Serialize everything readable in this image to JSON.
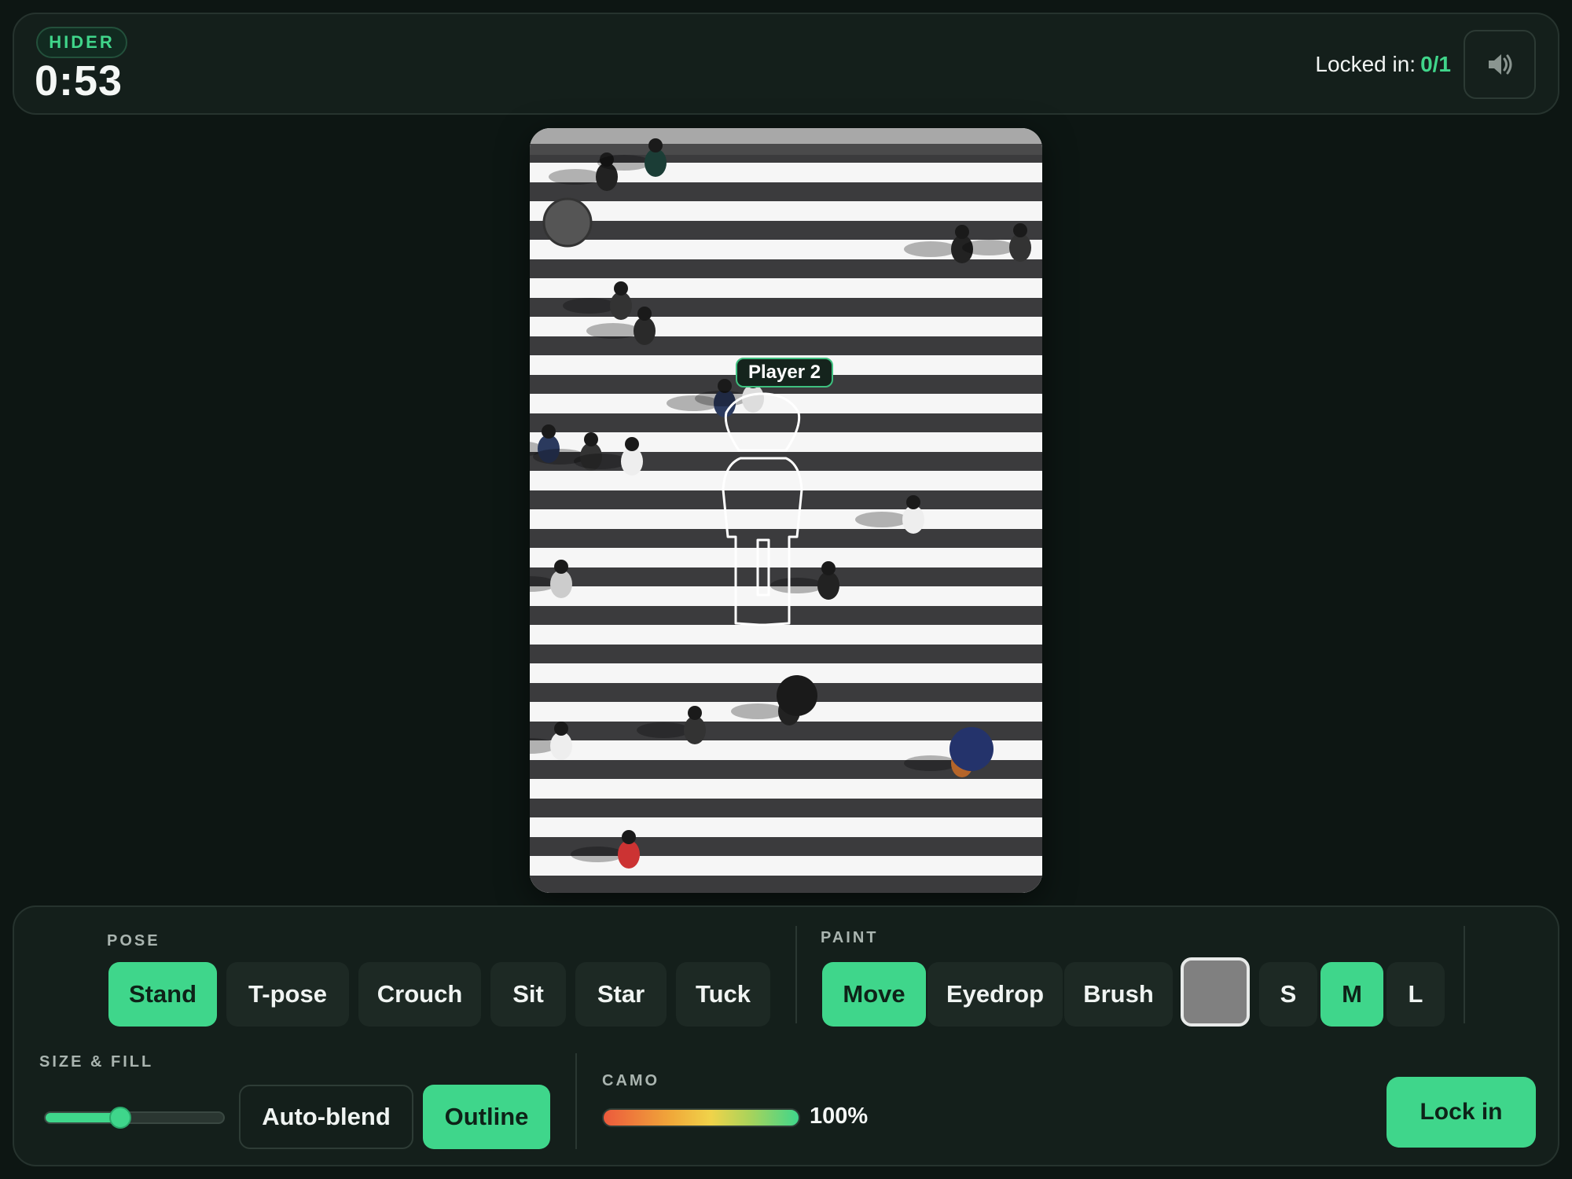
{
  "header": {
    "role": "HIDER",
    "timer": "0:53",
    "locked_label": "Locked in:",
    "locked_count": "0/1",
    "sound_icon": "speaker-icon"
  },
  "scene": {
    "player_tag": "Player 2"
  },
  "pose": {
    "label": "POSE",
    "options": [
      "Stand",
      "T-pose",
      "Crouch",
      "Sit",
      "Star",
      "Tuck"
    ],
    "selected": "Stand"
  },
  "paint": {
    "label": "PAINT",
    "tools": [
      "Move",
      "Eyedrop",
      "Brush"
    ],
    "selected_tool": "Move",
    "color": "#808080",
    "sizes": [
      "S",
      "M",
      "L"
    ],
    "selected_size": "M"
  },
  "size_fill": {
    "label": "SIZE & FILL",
    "slider_level": 0.42,
    "auto_blend": "Auto-blend",
    "outline": "Outline"
  },
  "camo": {
    "label": "CAMO",
    "value": "100%",
    "level": 1.0
  },
  "actions": {
    "lock_in": "Lock in"
  },
  "colors": {
    "accent": "#3fd68b",
    "background": "#0d1613",
    "panel": "#141f1b"
  }
}
